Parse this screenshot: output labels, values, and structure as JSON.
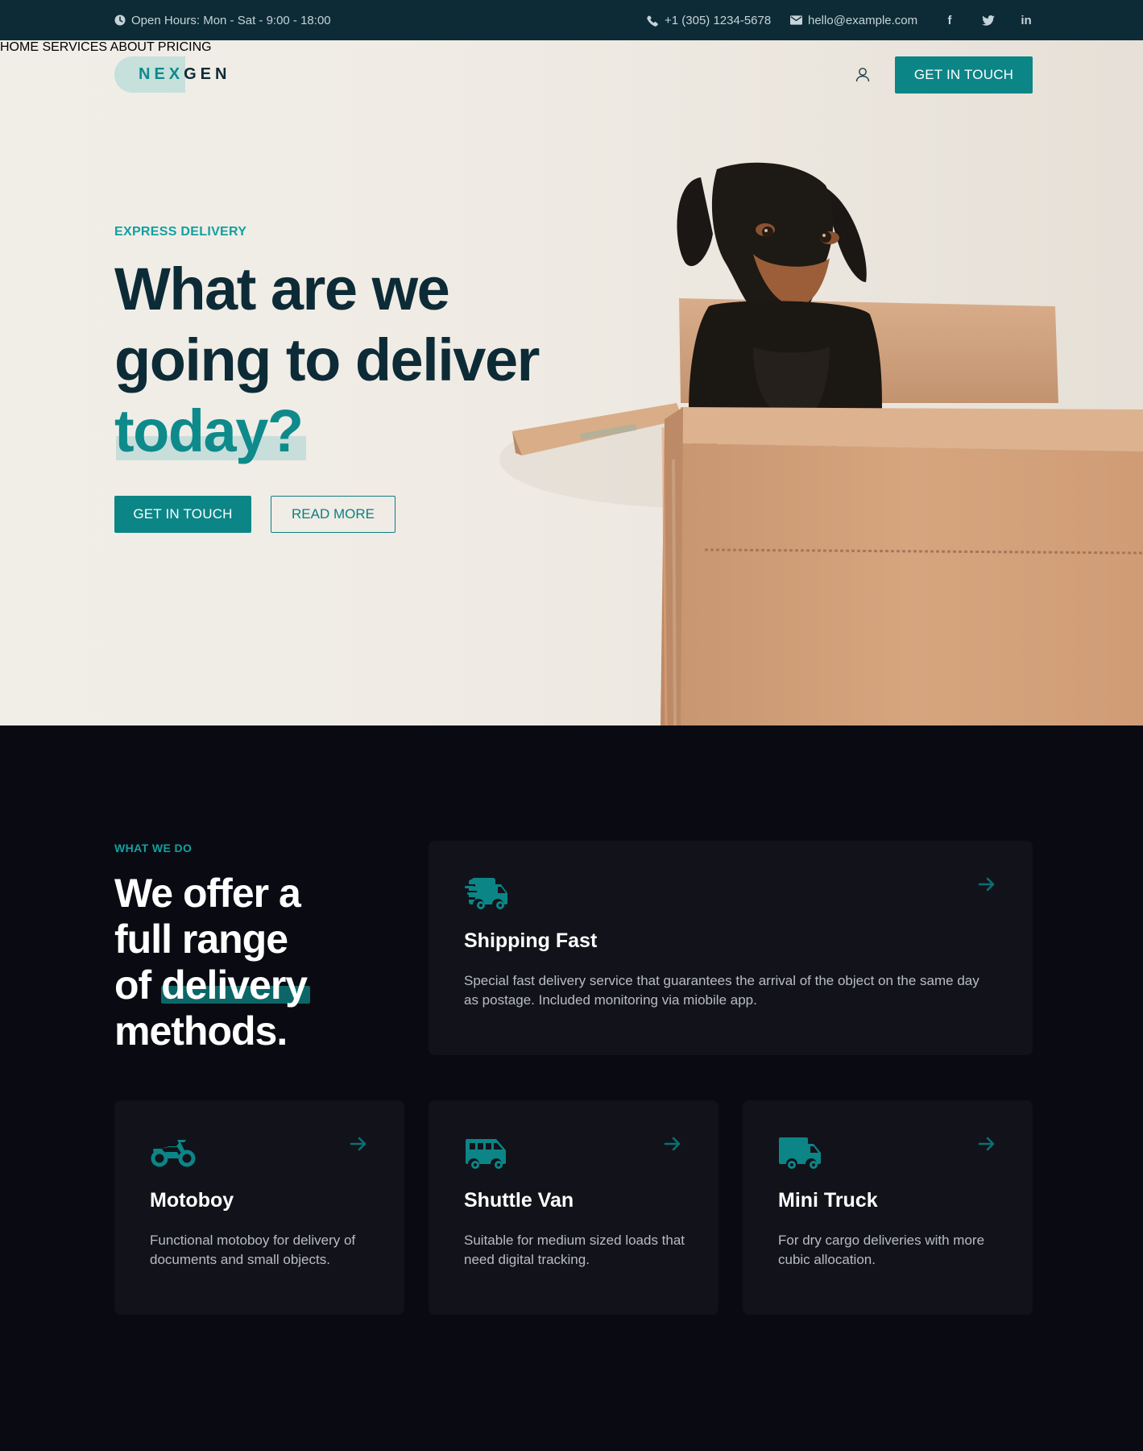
{
  "topbar": {
    "hours": "Open Hours: Mon - Sat - 9:00 - 18:00",
    "phone": "+1 (305) 1234-5678",
    "email": "hello@example.com",
    "social": {
      "facebook": "f",
      "twitter": "t",
      "linkedin": "in"
    }
  },
  "header": {
    "logo": {
      "part1": "NEX",
      "part2": "GEN"
    },
    "nav": [
      "HOME",
      "SERVICES",
      "ABOUT",
      "PRICING"
    ],
    "cta": "GET IN TOUCH"
  },
  "hero": {
    "eyebrow": "EXPRESS DELIVERY",
    "title_line1": "What are we",
    "title_line2": "going to deliver",
    "title_line3": "today?",
    "primary_button": "GET IN TOUCH",
    "secondary_button": "READ MORE"
  },
  "services": {
    "eyebrow": "WHAT WE DO",
    "title_line1": "We offer a",
    "title_line2": "full range",
    "title_line3_pre": "of ",
    "title_line3_hl": "delivery",
    "title_line4": "methods.",
    "cards": [
      {
        "icon": "shipping-fast-icon",
        "title": "Shipping Fast",
        "text": "Special fast delivery service that guarantees the arrival of the object on the same day as postage. Included monitoring via miobile app."
      },
      {
        "icon": "motorcycle-icon",
        "title": "Motoboy",
        "text": "Functional motoboy for delivery of documents and small objects."
      },
      {
        "icon": "shuttle-van-icon",
        "title": "Shuttle Van",
        "text": "Suitable for medium sized loads that need digital tracking."
      },
      {
        "icon": "mini-truck-icon",
        "title": "Mini Truck",
        "text": "For dry cargo deliveries with more cubic allocation."
      }
    ]
  },
  "colors": {
    "topbar": "#0d2b36",
    "accent": "#0c8587",
    "dark": "#0a0b12",
    "card": "#12131a"
  }
}
